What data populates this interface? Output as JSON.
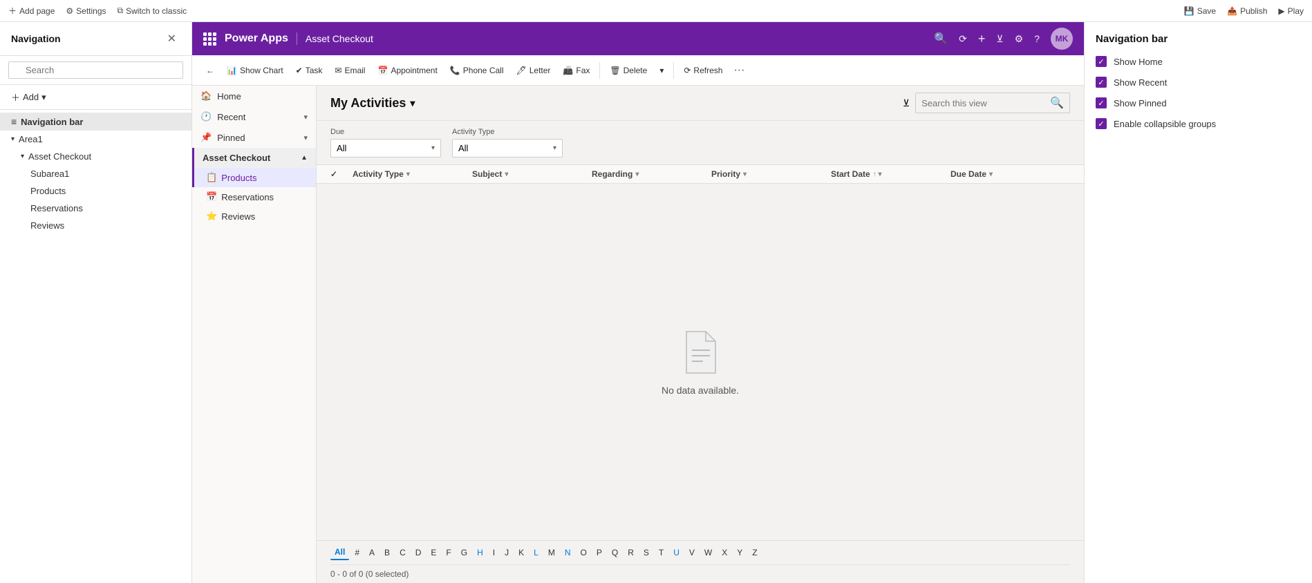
{
  "topBar": {
    "addPage": "Add page",
    "settings": "Settings",
    "switchToClassic": "Switch to classic",
    "save": "Save",
    "publish": "Publish",
    "play": "Play"
  },
  "navEditor": {
    "title": "Navigation",
    "searchPlaceholder": "Search",
    "addLabel": "Add",
    "items": [
      {
        "id": "nav-bar",
        "label": "Navigation bar",
        "icon": "≡",
        "indent": 0,
        "selected": true
      },
      {
        "id": "area1",
        "label": "Area1",
        "icon": "",
        "indent": 0,
        "chevron": "▾"
      },
      {
        "id": "asset-checkout",
        "label": "Asset Checkout",
        "icon": "",
        "indent": 1,
        "chevron": "▾"
      },
      {
        "id": "subarea1",
        "label": "Subarea1",
        "indent": 2
      },
      {
        "id": "products-sub",
        "label": "Products",
        "indent": 2
      },
      {
        "id": "reservations-sub",
        "label": "Reservations",
        "indent": 2
      },
      {
        "id": "reviews-sub",
        "label": "Reviews",
        "indent": 2
      }
    ]
  },
  "powerApps": {
    "gridIcon": "⊞",
    "brand": "Power Apps",
    "appName": "Asset Checkout",
    "headerIcons": {
      "search": "🔍",
      "refresh": "🔄",
      "add": "+",
      "filter": "⊻",
      "settings": "⚙",
      "help": "?"
    },
    "avatarText": "MK"
  },
  "toolbar": {
    "back": "←",
    "showChart": "Show Chart",
    "task": "Task",
    "email": "Email",
    "appointment": "Appointment",
    "phoneCall": "Phone Call",
    "letter": "Letter",
    "fax": "Fax",
    "delete": "Delete",
    "refresh": "Refresh"
  },
  "appSidebar": {
    "homeLabel": "Home",
    "recentLabel": "Recent",
    "pinnedLabel": "Pinned",
    "sectionLabel": "Asset Checkout",
    "subItems": [
      {
        "id": "products",
        "label": "Products",
        "active": true
      },
      {
        "id": "reservations",
        "label": "Reservations"
      },
      {
        "id": "reviews",
        "label": "Reviews"
      }
    ]
  },
  "viewHeader": {
    "title": "My Activities",
    "chevron": "▾",
    "filterIcon": "⊻",
    "searchPlaceholder": "Search this view"
  },
  "filters": {
    "dueLabel": "Due",
    "dueValue": "All",
    "activityTypeLabel": "Activity Type",
    "activityTypeValue": "All"
  },
  "tableColumns": [
    {
      "id": "activity-type",
      "label": "Activity Type",
      "sortable": true
    },
    {
      "id": "subject",
      "label": "Subject",
      "sortable": true
    },
    {
      "id": "regarding",
      "label": "Regarding",
      "sortable": true
    },
    {
      "id": "priority",
      "label": "Priority",
      "sortable": true
    },
    {
      "id": "start-date",
      "label": "Start Date",
      "sortable": true,
      "sorted": "asc"
    },
    {
      "id": "due-date",
      "label": "Due Date",
      "sortable": true
    }
  ],
  "emptyState": {
    "text": "No data available."
  },
  "pagination": {
    "alphaItems": [
      "All",
      "#",
      "A",
      "B",
      "C",
      "D",
      "E",
      "F",
      "G",
      "H",
      "I",
      "J",
      "K",
      "L",
      "M",
      "N",
      "O",
      "P",
      "Q",
      "R",
      "S",
      "T",
      "U",
      "V",
      "W",
      "X",
      "Y",
      "Z"
    ],
    "activeAlpha": "All",
    "highlightedLetters": [
      "H",
      "L",
      "N",
      "U"
    ],
    "recordCount": "0 - 0 of 0 (0 selected)"
  },
  "navBarPanel": {
    "title": "Navigation bar",
    "options": [
      {
        "id": "show-home",
        "label": "Show Home",
        "checked": true
      },
      {
        "id": "show-recent",
        "label": "Show Recent",
        "checked": true
      },
      {
        "id": "show-pinned",
        "label": "Show Pinned",
        "checked": true
      },
      {
        "id": "enable-collapsible",
        "label": "Enable collapsible groups",
        "checked": true
      }
    ]
  }
}
